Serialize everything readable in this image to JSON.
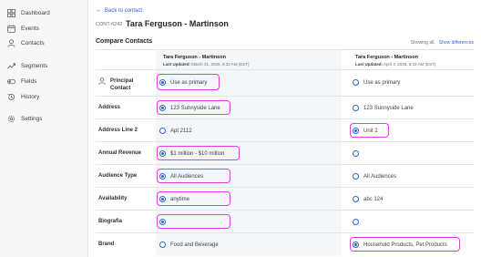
{
  "sidebar": {
    "items": [
      {
        "label": "Dashboard",
        "icon": "grid-icon"
      },
      {
        "label": "Events",
        "icon": "calendar-icon"
      },
      {
        "label": "Contacts",
        "icon": "person-icon"
      },
      {
        "label": "Segments",
        "icon": "trend-icon"
      },
      {
        "label": "Fields",
        "icon": "toggle-icon"
      },
      {
        "label": "History",
        "icon": "history-icon"
      },
      {
        "label": "Settings",
        "icon": "gear-icon"
      }
    ]
  },
  "header": {
    "back_label": "Back to contact",
    "contact_id": "CONT-6242",
    "contact_name": "Tara Ferguson - Martinson"
  },
  "compare": {
    "title": "Compare Contacts",
    "showing_label": "Showing all.",
    "show_differences_label": "Show differences",
    "columns": [
      {
        "name": "Tara Ferguson - Martinson",
        "updated_prefix": "Last Updated:",
        "updated": "March 31, 2025, 8:32 AM (EST)"
      },
      {
        "name": "Tara Ferguson - Martinson",
        "updated_prefix": "Last Updated:",
        "updated": "April 3, 2025, 8:33 AM (EST)"
      }
    ],
    "rows": [
      {
        "label": "Principal Contact",
        "a": "Use as primary",
        "b": "Use as primary",
        "selected": "a"
      },
      {
        "label": "Address",
        "a": "123 Sunnyside Lane",
        "b": "123 Sunnyside Lane",
        "selected": "a"
      },
      {
        "label": "Address Line 2",
        "a": "Apt 2112",
        "b": "Unit 2",
        "selected": "b"
      },
      {
        "label": "Annual Revenue",
        "a": "$1 million - $10 million",
        "b": "",
        "selected": "a"
      },
      {
        "label": "Audience Type",
        "a": "All Audiences",
        "b": "All Audiences",
        "selected": "a"
      },
      {
        "label": "Availability",
        "a": "anytime",
        "b": "abc 124",
        "selected": "a"
      },
      {
        "label": "Biografia",
        "a": "",
        "b": "",
        "selected": "a"
      },
      {
        "label": "Brand",
        "a": "Food and Beverage",
        "b": "Household Products, Pet Products",
        "selected": "b"
      }
    ]
  },
  "colors": {
    "accent": "#2d63d8",
    "highlight": "#df3fe0",
    "sidebar_bg": "#f7f7f8"
  }
}
